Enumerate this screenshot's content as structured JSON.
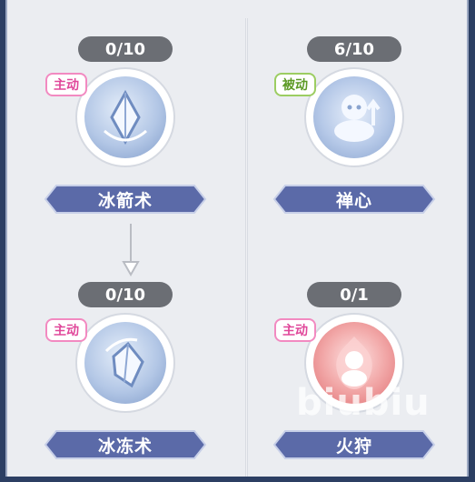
{
  "skills": [
    {
      "level": "0/10",
      "type": "主动",
      "name": "冰箭术",
      "icon": "ice-arrow-icon"
    },
    {
      "level": "6/10",
      "type": "被动",
      "name": "禅心",
      "icon": "meditation-icon"
    },
    {
      "level": "0/10",
      "type": "主动",
      "name": "冰冻术",
      "icon": "ice-freeze-icon"
    },
    {
      "level": "0/1",
      "type": "主动",
      "name": "火狩",
      "icon": "fire-hunt-icon"
    }
  ],
  "watermark": "biubiu",
  "colors": {
    "panel": "#ebedf1",
    "name_bar": "#5b6aa8",
    "level_pill": "#6b6e74",
    "active_badge": "#e0479a",
    "passive_badge": "#5c9a25"
  }
}
